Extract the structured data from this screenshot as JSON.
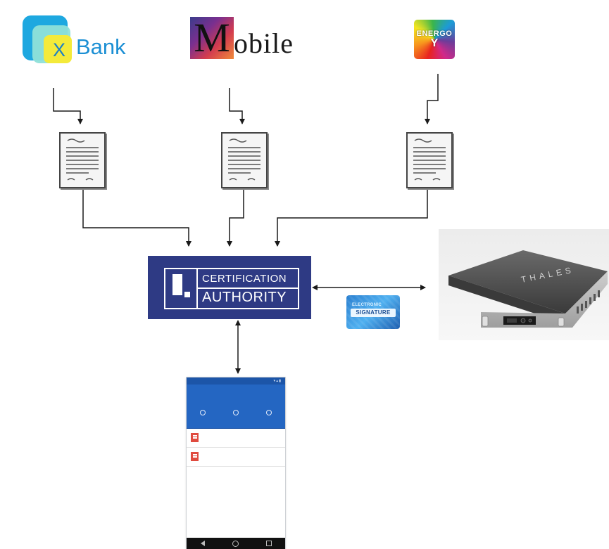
{
  "logos": {
    "xbank": {
      "letter": "X",
      "word": "Bank"
    },
    "mobile": {
      "first": "M",
      "rest": "obile"
    },
    "energo": {
      "name": "ENERGO",
      "letter": "Y"
    }
  },
  "authority": {
    "line1": "CERTIFICATION",
    "line2": "AUTHORITY"
  },
  "hsm": {
    "brand": "THALES"
  },
  "signature_badge": {
    "top": "ELECTRONIC",
    "bottom": "SIGNATURE"
  },
  "colors": {
    "authority_bg": "#2e3a84",
    "xbank_blue": "#1ea8e0",
    "xbank_yellow": "#f4ea3a",
    "phone_header": "#2466c2",
    "arrow": "#1a1a1a"
  },
  "icons": [
    "document-icon",
    "hsm-device-icon",
    "smartphone-icon",
    "electronic-signature-icon"
  ]
}
